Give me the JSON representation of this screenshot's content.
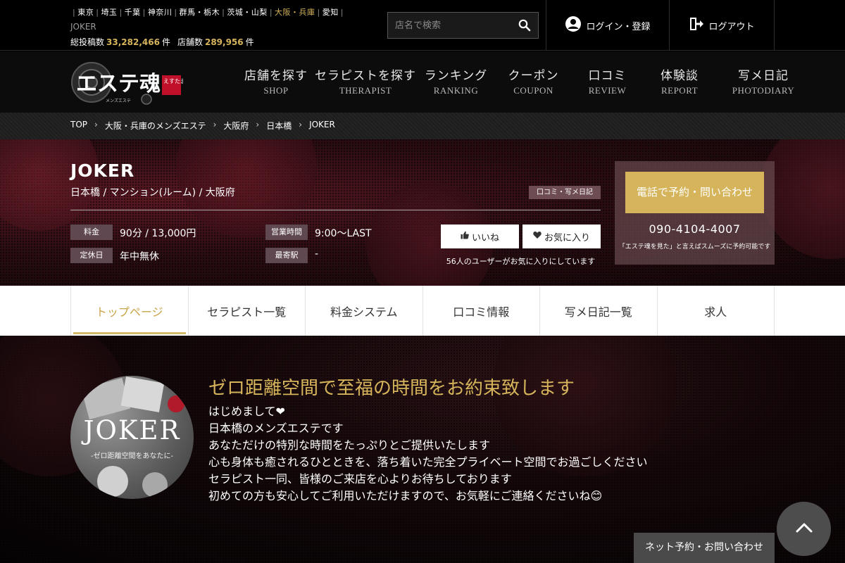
{
  "header": {
    "areas": [
      "東京",
      "埼玉",
      "千葉",
      "神奈川",
      "群馬・栃木",
      "茨城・山梨",
      "大阪・兵庫",
      "愛知"
    ],
    "active_area_index": 6,
    "shop_crumb": "JOKER",
    "counts": {
      "label1": "総投稿数",
      "value1": "33,282,466",
      "unit1": "件",
      "label2": "店舗数",
      "value2": "289,956",
      "unit2": "件"
    },
    "search_placeholder": "店名で検索",
    "login_label": "ログイン・登録",
    "logout_label": "ログアウト"
  },
  "logo": {
    "main": "エステ魂",
    "sub": "メンズエステ",
    "badge": "えすたま"
  },
  "nav": [
    {
      "jp": "店舗を探す",
      "en": "SHOP"
    },
    {
      "jp": "セラピストを探す",
      "en": "THERAPIST"
    },
    {
      "jp": "ランキング",
      "en": "RANKING"
    },
    {
      "jp": "クーポン",
      "en": "COUPON"
    },
    {
      "jp": "口コミ",
      "en": "REVIEW"
    },
    {
      "jp": "体験談",
      "en": "REPORT"
    },
    {
      "jp": "写メ日記",
      "en": "PHOTODIARY"
    }
  ],
  "breadcrumb": [
    "TOP",
    "大阪・兵庫のメンズエステ",
    "大阪府",
    "日本橋",
    "JOKER"
  ],
  "shop": {
    "name": "JOKER",
    "subtitle": "日本橋 / マンション(ルーム) / 大阪府",
    "tag_button": "口コミ・写メ日記",
    "info": {
      "price_label": "料金",
      "price_value": "90分 / 13,000円",
      "hours_label": "営業時間",
      "hours_value": "9:00～LAST",
      "holiday_label": "定休日",
      "holiday_value": "年中無休",
      "station_label": "最寄駅",
      "station_value": "-"
    },
    "like_label": "いいね",
    "fav_label": "お気に入り",
    "fav_note": "56人のユーザーがお気に入りにしています",
    "contact": {
      "button": "電話で予約・問い合わせ",
      "phone": "090-4104-4007",
      "note": "「エステ魂を見た」と言えばスムーズに予約可能です"
    }
  },
  "tabs": [
    "トップページ",
    "セラピスト一覧",
    "料金システム",
    "口コミ情報",
    "写メ日記一覧",
    "求人"
  ],
  "active_tab": 0,
  "content": {
    "avatar_brand": "JOKER",
    "avatar_tagline": "-ゼロ距離空間をあなたに-",
    "headline": "ゼロ距離空間で至福の時間をお約束致します",
    "lines": [
      "はじめまして❤",
      "日本橋のメンズエステです",
      "あなただけの特別な時間をたっぷりとご提供いたします",
      "心も身体も癒されるひとときを、落ち着いた完全プライベート空間でお過ごしください",
      "セラピスト一同、皆様のご来店を心よりお待ちしております",
      "初めての方も安心してご利用いただけますので、お気軽にご連絡くださいね😊"
    ]
  },
  "floating": {
    "reserve": "ネット予約・お問い合わせ"
  }
}
